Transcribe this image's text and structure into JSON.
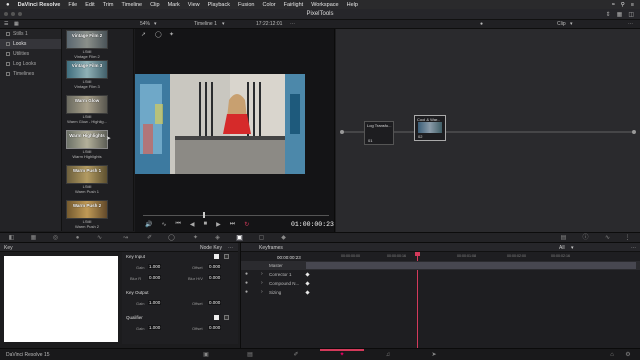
{
  "menubar": {
    "apple": "",
    "app": "DaVinci Resolve",
    "items": [
      "File",
      "Edit",
      "Trim",
      "Timeline",
      "Clip",
      "Mark",
      "View",
      "Playback",
      "Fusion",
      "Color",
      "Fairlight",
      "Workspace",
      "Help"
    ]
  },
  "topbar": {
    "title": "PixelTools"
  },
  "toolbar2": {
    "zoom": "54%",
    "timeline": "Timeline 1",
    "timecode": "17:22:12:01",
    "clip_label": "Clip"
  },
  "categories": [
    {
      "label": "Stills 1"
    },
    {
      "label": "Looks"
    },
    {
      "label": "Utilities"
    },
    {
      "label": "Log Looks"
    },
    {
      "label": "Timelines"
    }
  ],
  "luts": [
    {
      "thumb": "Vintage Film 2",
      "cap1": "LStill",
      "cap2": "Vintage Film 2"
    },
    {
      "thumb": "Vintage Film 3",
      "cap1": "LStill",
      "cap2": "Vintage Film 3"
    },
    {
      "thumb": "Warm Glow",
      "cap1": "LStill",
      "cap2": "Warm Glow - Highlig..."
    },
    {
      "thumb": "Warm Highlights",
      "cap1": "LStill",
      "cap2": "Warm Highlights"
    },
    {
      "thumb": "Warm Push 1",
      "cap1": "LStill",
      "cap2": "Warm Push 1"
    },
    {
      "thumb": "Warm Push 2",
      "cap1": "LStill",
      "cap2": "Warm Push 2"
    }
  ],
  "viewer": {
    "timecode": "01:00:00:23"
  },
  "nodes": [
    {
      "title": "Log Transfo...",
      "num": "01"
    },
    {
      "title": "Cool & War...",
      "num": "02"
    }
  ],
  "key_panel": {
    "title": "Key",
    "node_key": "Node Key",
    "key_input": "Key Input",
    "key_output": "Key Output",
    "qualifier": "Qualifier",
    "gain": "Gain",
    "blur_r": "Blur R",
    "offset": "Offset",
    "blur_hv": "Blur H/V",
    "v_gain1": "1.000",
    "v_blurr": "0.000",
    "v_off1": "0.000",
    "v_blurhv": "0.000",
    "v_gain2": "1.000",
    "v_off2": "0.000",
    "v_gain3": "1.000",
    "v_off3": "0.000"
  },
  "keyframes": {
    "title": "Keyframes",
    "all": "All",
    "timecode": "00:00:00:23",
    "ruler": [
      "00:00:00:00",
      "00:00:00:16",
      "00:00:01:08",
      "00:00:02:00",
      "00:00:02:16"
    ],
    "master": "Master",
    "rows": [
      "Corrector 1",
      "Compound N...",
      "Sizing"
    ]
  },
  "pagebar": {
    "brand": "DaVinci Resolve 15"
  },
  "colors": {
    "accent": "#d33a5b",
    "node_link": "#7ab0ff"
  }
}
